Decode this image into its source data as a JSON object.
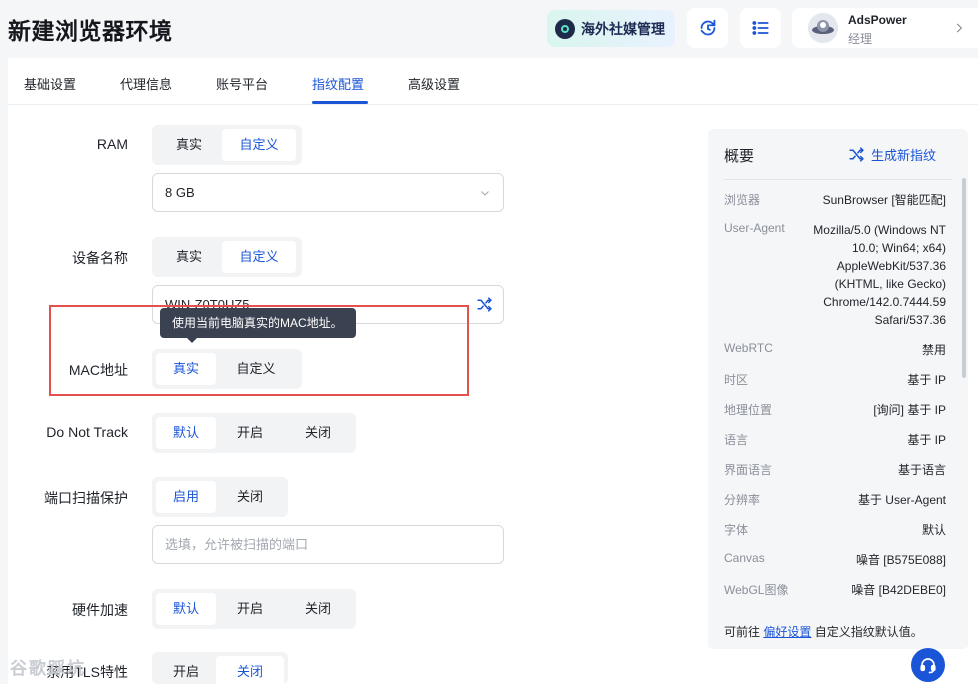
{
  "header": {
    "title": "新建浏览器环境",
    "social_label": "海外社媒管理",
    "user": {
      "name": "AdsPower",
      "role": "经理"
    }
  },
  "tabs": [
    {
      "label": "基础设置",
      "active": false
    },
    {
      "label": "代理信息",
      "active": false
    },
    {
      "label": "账号平台",
      "active": false
    },
    {
      "label": "指纹配置",
      "active": true
    },
    {
      "label": "高级设置",
      "active": false
    }
  ],
  "form": {
    "ram": {
      "label": "RAM",
      "options": [
        "真实",
        "自定义"
      ],
      "selected": "自定义",
      "value": "8 GB"
    },
    "device_name": {
      "label": "设备名称",
      "options": [
        "真实",
        "自定义"
      ],
      "selected": "自定义",
      "value": "WIN-Z0T0UZ5"
    },
    "mac": {
      "label": "MAC地址",
      "options": [
        "真实",
        "自定义"
      ],
      "selected": "真实",
      "tooltip": "使用当前电脑真实的MAC地址。"
    },
    "dnt": {
      "label": "Do Not Track",
      "options": [
        "默认",
        "开启",
        "关闭"
      ],
      "selected": "默认"
    },
    "port_scan": {
      "label": "端口扫描保护",
      "options": [
        "启用",
        "关闭"
      ],
      "selected": "启用",
      "placeholder": "选填，允许被扫描的端口"
    },
    "hw_accel": {
      "label": "硬件加速",
      "options": [
        "默认",
        "开启",
        "关闭"
      ],
      "selected": "默认"
    },
    "partial_row": {
      "label": "禁用TLS特性",
      "options": [
        "开启",
        "关闭"
      ],
      "selected": "关闭"
    }
  },
  "summary": {
    "title": "概要",
    "generate_label": "生成新指纹",
    "rows": [
      {
        "k": "浏览器",
        "v": "SunBrowser [智能匹配]"
      },
      {
        "k": "User-Agent",
        "v": "Mozilla/5.0 (Windows NT 10.0; Win64; x64) AppleWebKit/537.36 (KHTML, like Gecko) Chrome/142.0.7444.59 Safari/537.36"
      },
      {
        "k": "WebRTC",
        "v": "禁用"
      },
      {
        "k": "时区",
        "v": "基于 IP"
      },
      {
        "k": "地理位置",
        "v": "[询问] 基于 IP"
      },
      {
        "k": "语言",
        "v": "基于 IP"
      },
      {
        "k": "界面语言",
        "v": "基于语言"
      },
      {
        "k": "分辨率",
        "v": "基于 User-Agent"
      },
      {
        "k": "字体",
        "v": "默认"
      },
      {
        "k": "Canvas",
        "v": "噪音 [B575E088]"
      },
      {
        "k": "WebGL图像",
        "v": "噪音 [B42DEBE0]"
      }
    ],
    "footer_prefix": "可前往 ",
    "footer_link": "偏好设置",
    "footer_suffix": " 自定义指纹默认值。"
  },
  "watermark": "谷歌踩坑",
  "colors": {
    "accent": "#1a55d8",
    "highlight": "#e4504e"
  }
}
